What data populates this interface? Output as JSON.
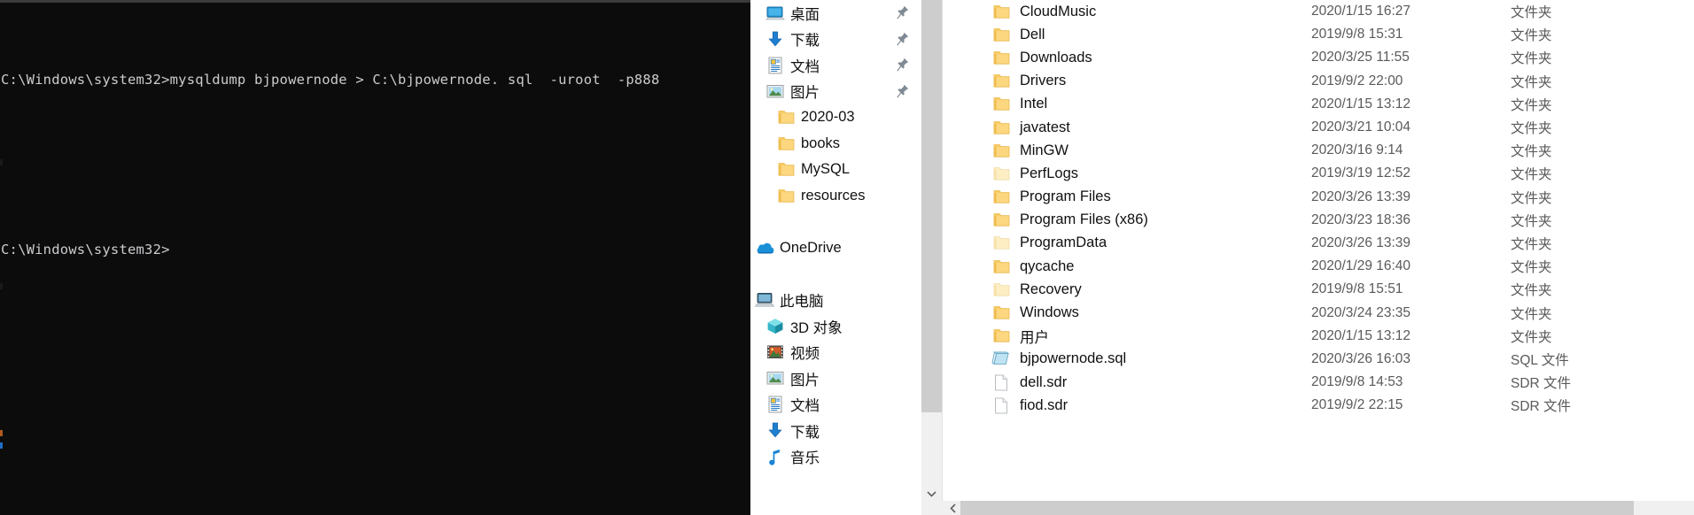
{
  "terminal": {
    "lines": [
      "C:\\Windows\\system32>mysqldump bjpowernode > C:\\bjpowernode. sql  -uroot  -p888",
      "",
      "C:\\Windows\\system32>"
    ],
    "background_color": "#0c0c0c",
    "text_color": "#ccccd0"
  },
  "explorer": {
    "nav_pane": {
      "items": [
        {
          "label": "桌面",
          "icon": "desktop-icon",
          "indent": "indent-1",
          "pinned": true
        },
        {
          "label": "下载",
          "icon": "download-icon",
          "indent": "indent-1",
          "pinned": true
        },
        {
          "label": "文档",
          "icon": "documents-icon",
          "indent": "indent-1",
          "pinned": true
        },
        {
          "label": "图片",
          "icon": "pictures-icon",
          "indent": "indent-1",
          "pinned": true
        },
        {
          "label": "2020-03",
          "icon": "folder-icon",
          "indent": "indent-2",
          "pinned": false
        },
        {
          "label": "books",
          "icon": "folder-icon",
          "indent": "indent-2",
          "pinned": false
        },
        {
          "label": "MySQL",
          "icon": "folder-icon",
          "indent": "indent-2",
          "pinned": false
        },
        {
          "label": "resources",
          "icon": "folder-icon",
          "indent": "indent-2",
          "pinned": false
        },
        {
          "label": "",
          "icon": "spacer",
          "indent": "indent-1",
          "pinned": false
        },
        {
          "label": "OneDrive",
          "icon": "onedrive-icon",
          "indent": "root",
          "pinned": false
        },
        {
          "label": "",
          "icon": "spacer",
          "indent": "indent-1",
          "pinned": false
        },
        {
          "label": "此电脑",
          "icon": "thispc-icon",
          "indent": "root",
          "pinned": false
        },
        {
          "label": "3D 对象",
          "icon": "3dobjects-icon",
          "indent": "indent-1",
          "pinned": false
        },
        {
          "label": "视频",
          "icon": "videos-icon",
          "indent": "indent-1",
          "pinned": false
        },
        {
          "label": "图片",
          "icon": "pictures-icon",
          "indent": "indent-1",
          "pinned": false
        },
        {
          "label": "文档",
          "icon": "documents-icon",
          "indent": "indent-1",
          "pinned": false
        },
        {
          "label": "下载",
          "icon": "download-icon",
          "indent": "indent-1",
          "pinned": false
        },
        {
          "label": "音乐",
          "icon": "music-icon",
          "indent": "indent-1",
          "pinned": false
        }
      ]
    },
    "file_list": {
      "rows": [
        {
          "name": "CloudMusic",
          "icon": "folder-icon",
          "date": "2020/1/15 16:27",
          "type": "文件夹"
        },
        {
          "name": "Dell",
          "icon": "folder-icon",
          "date": "2019/9/8 15:31",
          "type": "文件夹"
        },
        {
          "name": "Downloads",
          "icon": "folder-icon",
          "date": "2020/3/25 11:55",
          "type": "文件夹"
        },
        {
          "name": "Drivers",
          "icon": "folder-icon",
          "date": "2019/9/2 22:00",
          "type": "文件夹"
        },
        {
          "name": "Intel",
          "icon": "folder-icon",
          "date": "2020/1/15 13:12",
          "type": "文件夹"
        },
        {
          "name": "javatest",
          "icon": "folder-icon",
          "date": "2020/3/21 10:04",
          "type": "文件夹"
        },
        {
          "name": "MinGW",
          "icon": "folder-icon",
          "date": "2020/3/16 9:14",
          "type": "文件夹"
        },
        {
          "name": "PerfLogs",
          "icon": "folder-dim-icon",
          "date": "2019/3/19 12:52",
          "type": "文件夹"
        },
        {
          "name": "Program Files",
          "icon": "folder-icon",
          "date": "2020/3/26 13:39",
          "type": "文件夹"
        },
        {
          "name": "Program Files (x86)",
          "icon": "folder-icon",
          "date": "2020/3/23 18:36",
          "type": "文件夹"
        },
        {
          "name": "ProgramData",
          "icon": "folder-dim-icon",
          "date": "2020/3/26 13:39",
          "type": "文件夹"
        },
        {
          "name": "qycache",
          "icon": "folder-icon",
          "date": "2020/1/29 16:40",
          "type": "文件夹"
        },
        {
          "name": "Recovery",
          "icon": "folder-dim-icon",
          "date": "2019/9/8 15:51",
          "type": "文件夹"
        },
        {
          "name": "Windows",
          "icon": "folder-icon",
          "date": "2020/3/24 23:35",
          "type": "文件夹"
        },
        {
          "name": "用户",
          "icon": "folder-icon",
          "date": "2020/1/15 13:12",
          "type": "文件夹"
        },
        {
          "name": "bjpowernode.sql",
          "icon": "sql-file-icon",
          "date": "2020/3/26 16:03",
          "type": "SQL 文件"
        },
        {
          "name": "dell.sdr",
          "icon": "blank-file-icon",
          "date": "2019/9/8 14:53",
          "type": "SDR 文件"
        },
        {
          "name": "fiod.sdr",
          "icon": "blank-file-icon",
          "date": "2019/9/2 22:15",
          "type": "SDR 文件"
        }
      ]
    }
  }
}
